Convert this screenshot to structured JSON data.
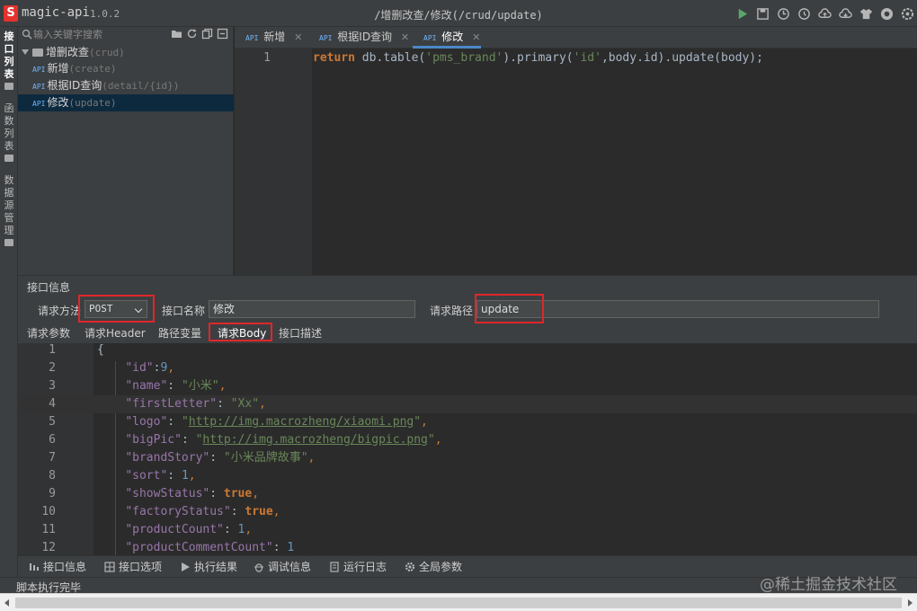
{
  "app": {
    "logo_letter": "S",
    "name": "magic-api",
    "version": "1.0.2",
    "title_path": "/增删改查/修改(/crud/update)"
  },
  "toolbar_icons": [
    "run-icon",
    "save-icon",
    "history-icon",
    "clock-icon",
    "cloud-upload-icon",
    "cloud-download-icon",
    "skin-icon",
    "github-icon",
    "settings-icon"
  ],
  "left_strip": [
    {
      "label": "接口列表",
      "chars": [
        "接",
        "口",
        "列",
        "表"
      ],
      "active": true
    },
    {
      "label": "函数列表",
      "chars": [
        "函",
        "数",
        "列",
        "表"
      ],
      "active": false
    },
    {
      "label": "数据源管理",
      "chars": [
        "数",
        "据",
        "源",
        "管",
        "理"
      ],
      "active": false
    }
  ],
  "tree": {
    "search_placeholder": "输入关键字搜索",
    "tool_icons": [
      "folder-add-icon",
      "refresh-icon",
      "copy-icon",
      "collapse-icon"
    ],
    "group": {
      "name": "增删改查",
      "path": "(crud)"
    },
    "items": [
      {
        "tag": "API",
        "name": "新增",
        "path": "(create)",
        "selected": false
      },
      {
        "tag": "API",
        "name": "根据ID查询",
        "path": "(detail/{id})",
        "selected": false
      },
      {
        "tag": "API",
        "name": "修改",
        "path": "(update)",
        "selected": true
      }
    ]
  },
  "editor": {
    "tabs": [
      {
        "tag": "API",
        "label": "新增",
        "active": false
      },
      {
        "tag": "API",
        "label": "根据ID查询",
        "active": false
      },
      {
        "tag": "API",
        "label": "修改",
        "active": true
      }
    ],
    "line_number": "1",
    "code": {
      "keyword": "return",
      "part1": " db.table(",
      "str1": "'pms_brand'",
      "part2": ").primary(",
      "str2": "'id'",
      "part3": ",body.id).update(body);"
    }
  },
  "info_panel": {
    "title": "接口信息",
    "method_label": "请求方法",
    "method_value": "POST",
    "name_label": "接口名称",
    "name_value": "修改",
    "path_label": "请求路径",
    "path_value": "update",
    "subtabs": [
      "请求参数",
      "请求Header",
      "路径变量",
      "请求Body",
      "接口描述"
    ],
    "active_subtab": "请求Body"
  },
  "request_body_lines": [
    {
      "n": "1",
      "kind": "brace",
      "text": "{"
    },
    {
      "n": "2",
      "kind": "num",
      "key": "\"id\"",
      "sep": ":",
      "value": "9",
      "tail": ","
    },
    {
      "n": "3",
      "kind": "str",
      "key": "\"name\"",
      "sep": ": ",
      "value": "\"小米\"",
      "tail": ","
    },
    {
      "n": "4",
      "kind": "str",
      "key": "\"firstLetter\"",
      "sep": ": ",
      "value": "\"Xx\"",
      "tail": ","
    },
    {
      "n": "5",
      "kind": "url",
      "key": "\"logo\"",
      "sep": ": ",
      "q1": "\"",
      "value": "http://img.macrozheng/xiaomi.png",
      "q2": "\"",
      "tail": ","
    },
    {
      "n": "6",
      "kind": "url",
      "key": "\"bigPic\"",
      "sep": ": ",
      "q1": "\"",
      "value": "http://img.macrozheng/bigpic.png",
      "q2": "\"",
      "tail": ","
    },
    {
      "n": "7",
      "kind": "str",
      "key": "\"brandStory\"",
      "sep": ": ",
      "value": "\"小米品牌故事\"",
      "tail": ","
    },
    {
      "n": "8",
      "kind": "num",
      "key": "\"sort\"",
      "sep": ": ",
      "value": "1",
      "tail": ","
    },
    {
      "n": "9",
      "kind": "bool",
      "key": "\"showStatus\"",
      "sep": ": ",
      "value": "true",
      "tail": ","
    },
    {
      "n": "10",
      "kind": "bool",
      "key": "\"factoryStatus\"",
      "sep": ": ",
      "value": "true",
      "tail": ","
    },
    {
      "n": "11",
      "kind": "num",
      "key": "\"productCount\"",
      "sep": ": ",
      "value": "1",
      "tail": ","
    },
    {
      "n": "12",
      "kind": "num",
      "key": "\"productCommentCount\"",
      "sep": ": ",
      "value": "1",
      "tail": ""
    }
  ],
  "bottom_tabs": [
    {
      "icon": "info-icon",
      "label": "接口信息"
    },
    {
      "icon": "options-icon",
      "label": "接口选项"
    },
    {
      "icon": "play-icon",
      "label": "执行结果"
    },
    {
      "icon": "debug-icon",
      "label": "调试信息"
    },
    {
      "icon": "log-icon",
      "label": "运行日志"
    },
    {
      "icon": "gear-icon",
      "label": "全局参数"
    }
  ],
  "status": {
    "text": "脚本执行完毕",
    "watermark": "@稀土掘金技术社区"
  },
  "colors": {
    "accent": "#4a88c7",
    "highlight_box": "#e0262a",
    "run_green": "#59a869",
    "logo_red": "#e4332f"
  }
}
